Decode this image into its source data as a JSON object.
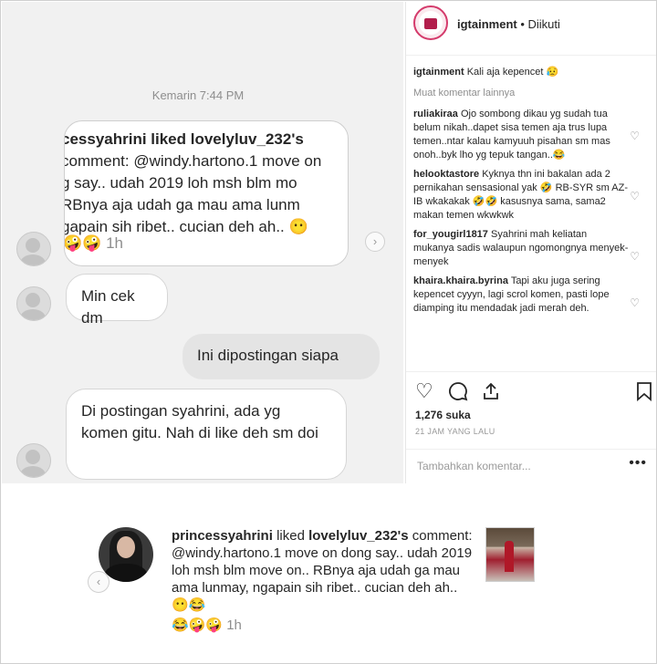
{
  "chat": {
    "timestamp": "Kemarin 7:44 PM",
    "shared_notification": {
      "lines": [
        "cessyahrini liked lovelyluv_232's",
        "comment: @windy.hartono.1 move on",
        "g say.. udah 2019 loh msh blm mo",
        "RBnya aja udah ga mau ama lunm",
        "gapain sih ribet.. cucian deh ah.. 😶"
      ],
      "emoji_row": "🤪🤪",
      "time": "1h"
    },
    "messages": [
      {
        "side": "in",
        "text": "Min cek dm"
      },
      {
        "side": "out",
        "text": "Ini dipostingan siapa"
      },
      {
        "side": "in",
        "text": "Di postingan syahrini, ada yg komen gitu. Nah di like deh sm doi"
      }
    ]
  },
  "post": {
    "username": "igtainment",
    "follow_status": "• Diikuti",
    "caption": {
      "user": "igtainment",
      "text": "Kali aja kepencet 😥"
    },
    "load_more": "Muat komentar lainnya",
    "comments": [
      {
        "user": "ruliakiraa",
        "text": "Ojo sombong dikau yg sudah tua belum nikah..dapet sisa temen aja trus lupa temen..ntar kalau kamyuuh pisahan sm mas onoh..byk lho yg tepuk tangan..😂"
      },
      {
        "user": "helooktastore",
        "text": "Kyknya thn ini bakalan ada 2 pernikahan sensasional yak 🤣 RB-SYR sm AZ-IB wkakakak 🤣🤣 kasusnya sama, sama2 makan temen wkwkwk"
      },
      {
        "user": "for_yougirl1817",
        "text": "Syahrini mah keliatan mukanya sadis walaupun ngomongnya menyek-menyek"
      },
      {
        "user": "khaira.khaira.byrina",
        "text": "Tapi aku juga sering kepencet cyyyn, lagi scrol komen, pasti lope diamping itu mendadak jadi merah deh."
      }
    ],
    "likes": "1,276 suka",
    "time_ago": "21 JAM YANG LALU",
    "add_comment_placeholder": "Tambahkan komentar...",
    "more_glyph": "•••"
  },
  "notification": {
    "user": "princessyahrini",
    "liked_text": "liked",
    "target": "lovelyluv_232's",
    "body": "comment: @windy.hartono.1 move on dong say.. udah 2019 loh msh blm move on.. RBnya aja udah ga mau ama lunmay, ngapain sih ribet.. cucian deh ah.. 😶😂",
    "emoji_row": "😂🤪🤪",
    "time": "1h"
  },
  "icons": {
    "heart": "heart-icon",
    "comment": "comment-icon",
    "share": "share-icon",
    "bookmark": "bookmark-icon",
    "chevron": "chevron-right-icon"
  },
  "colors": {
    "accent": "#d43a6b",
    "chat_bg": "#f1f1f1",
    "muted": "#8e8e8e"
  }
}
